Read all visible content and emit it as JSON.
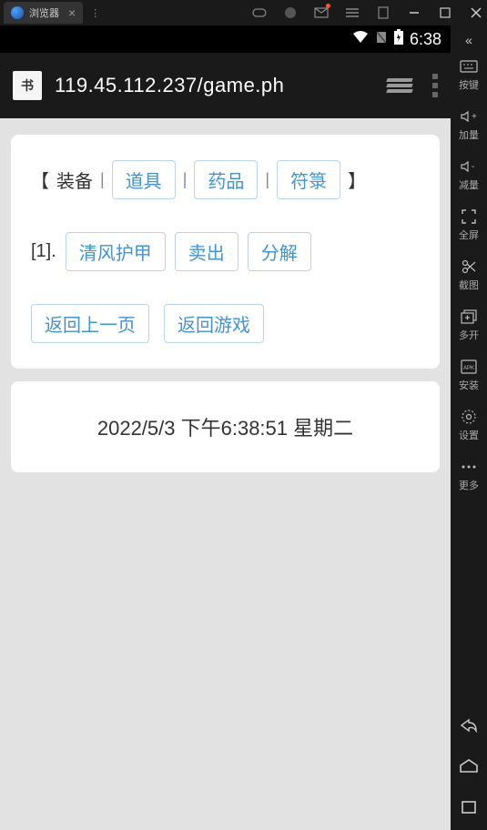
{
  "window": {
    "tab_title": "浏览器"
  },
  "status": {
    "time": "6:38"
  },
  "url": {
    "text": "119.45.112.237/game.ph"
  },
  "game": {
    "categories": {
      "header": "装备",
      "items": [
        "道具",
        "药品",
        "符箓"
      ]
    },
    "item": {
      "index": "[1].",
      "name": "清风护甲",
      "actions": [
        "卖出",
        "分解"
      ]
    },
    "nav": {
      "back": "返回上一页",
      "return": "返回游戏"
    },
    "timestamp": "2022/5/3 下午6:38:51 星期二"
  },
  "sidebar": {
    "items": [
      {
        "label": "按键"
      },
      {
        "label": "加量"
      },
      {
        "label": "减量"
      },
      {
        "label": "全屏"
      },
      {
        "label": "截图"
      },
      {
        "label": "多开"
      },
      {
        "label": "安装"
      },
      {
        "label": "设置"
      },
      {
        "label": "更多"
      }
    ]
  }
}
